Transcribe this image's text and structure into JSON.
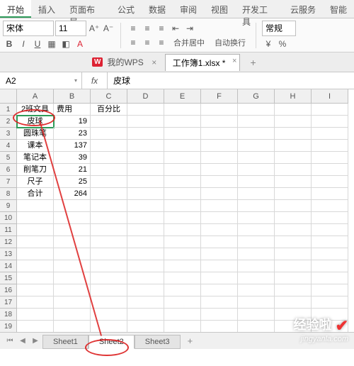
{
  "ribbon": {
    "tabs": [
      "开始",
      "插入",
      "页面布局",
      "公式",
      "数据",
      "审阅",
      "视图",
      "开发工具",
      "云服务",
      "智能"
    ],
    "active_index": 0
  },
  "toolbar": {
    "font": "宋体",
    "size": "11",
    "merge_label": "合并居中",
    "wrap_label": "自动换行",
    "style_label": "常规"
  },
  "docbar": {
    "wps_badge": "W",
    "wps_label": "我的WPS",
    "doc_name": "工作簿1.xlsx *"
  },
  "formula": {
    "name_box": "A2",
    "fx": "fx",
    "value": "皮球"
  },
  "grid": {
    "columns": [
      "A",
      "B",
      "C",
      "D",
      "E",
      "F",
      "G",
      "H",
      "I"
    ],
    "row_count": 21,
    "data": [
      [
        "2班文具",
        "费用",
        "百分比",
        "",
        "",
        "",
        "",
        "",
        ""
      ],
      [
        "皮球",
        "19",
        "",
        "",
        "",
        "",
        "",
        "",
        ""
      ],
      [
        "圆珠笔",
        "23",
        "",
        "",
        "",
        "",
        "",
        "",
        ""
      ],
      [
        "课本",
        "137",
        "",
        "",
        "",
        "",
        "",
        "",
        ""
      ],
      [
        "笔记本",
        "39",
        "",
        "",
        "",
        "",
        "",
        "",
        ""
      ],
      [
        "削笔刀",
        "21",
        "",
        "",
        "",
        "",
        "",
        "",
        ""
      ],
      [
        "尺子",
        "25",
        "",
        "",
        "",
        "",
        "",
        "",
        ""
      ],
      [
        "合计",
        "264",
        "",
        "",
        "",
        "",
        "",
        "",
        ""
      ]
    ],
    "active_cell": {
      "row": 1,
      "col": 0
    }
  },
  "sheets": {
    "tabs": [
      "Sheet1",
      "Sheet2",
      "Sheet3"
    ],
    "active_index": 1
  },
  "watermark": {
    "line1": "经验啦",
    "line2": "jingyanla.com"
  }
}
